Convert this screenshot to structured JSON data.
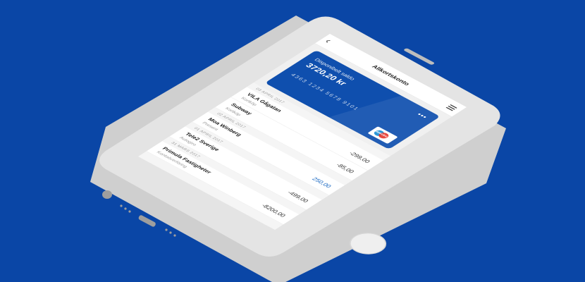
{
  "app": {
    "title": "Allkortskonto",
    "back_icon": "chevron-left-icon",
    "menu_icon": "hamburger-menu-icon"
  },
  "card": {
    "balance_label": "Disponibelt saldo",
    "balance_value": "3720,20 kr",
    "number": "4363 1234 5678 9101",
    "more_icon": "ellipsis-icon",
    "brand": "Maestro",
    "color": "#0f4fae"
  },
  "transactions": {
    "date_1": "03 APRIL 2017",
    "date_2": "02 APRIL 2017",
    "date_3": "01 APRIL 2017",
    "date_4": "31 MARS 2017",
    "rows": [
      {
        "name": "VILA Gågatan",
        "sub": "Kortköp",
        "amount": "-299,00"
      },
      {
        "name": "Subway",
        "sub": "Kortköp",
        "amount": "-85,00"
      },
      {
        "name": "Moa Winberg",
        "sub": "Present",
        "amount": "250,00"
      },
      {
        "name": "Tele2 Sverige",
        "sub": "Autogiro",
        "amount": "-499,00"
      },
      {
        "name": "Primula Fastigheter",
        "sub": "Kontoöverföring",
        "amount": "-8200,00"
      }
    ]
  },
  "colors": {
    "background": "#0a46a6",
    "positive_amount": "#1565c0"
  }
}
